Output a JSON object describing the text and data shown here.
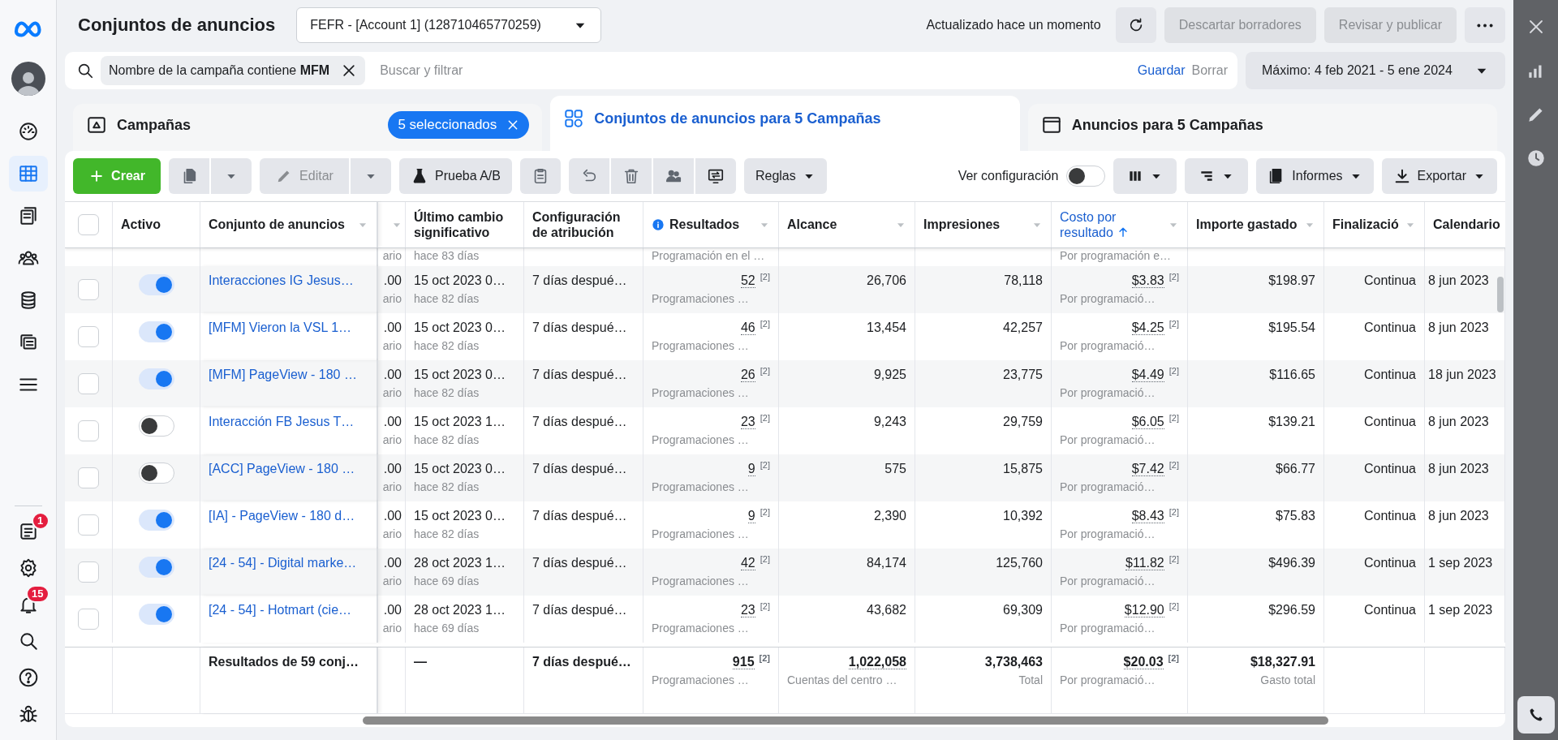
{
  "sidebar": {
    "top_items": [
      {
        "kind": "dashboard",
        "selected": false
      },
      {
        "kind": "table",
        "selected": true
      },
      {
        "kind": "pages",
        "selected": false
      },
      {
        "kind": "people",
        "selected": false
      },
      {
        "kind": "database",
        "selected": false
      },
      {
        "kind": "layers",
        "selected": false
      },
      {
        "kind": "menu",
        "selected": false
      }
    ],
    "bottom_items": [
      {
        "kind": "notes",
        "selected": false,
        "badge": "1"
      },
      {
        "kind": "settings",
        "selected": false
      },
      {
        "kind": "bell",
        "selected": false,
        "badge": "15"
      },
      {
        "kind": "search",
        "selected": false
      },
      {
        "kind": "help",
        "selected": false
      },
      {
        "kind": "bug",
        "selected": false
      }
    ]
  },
  "header": {
    "title": "Conjuntos de anuncios",
    "account": "FEFR - [Account 1] (128710465770259)",
    "status": "Actualizado hace un momento",
    "buttons": [
      {
        "label": "Descartar borradores",
        "disabled": true
      },
      {
        "label": "Revisar y publicar",
        "disabled": true
      }
    ]
  },
  "filter": {
    "chip_text": "Nombre de la campaña contiene **MFM**",
    "placeholder": "Buscar y filtrar",
    "save": "Guardar",
    "clear": "Borrar"
  },
  "date_range": "Máximo: 4 feb 2021 - 5 ene 2024",
  "tabs": [
    {
      "kind": "campaigns",
      "label": "Campañas",
      "selected": false,
      "badge": "5 seleccionados"
    },
    {
      "kind": "adsets",
      "label": "Conjuntos de anuncios para 5 Campañas",
      "selected": true
    },
    {
      "kind": "ads",
      "label": "Anuncios para 5 Campañas",
      "selected": false
    }
  ],
  "toolbar": {
    "create": "Crear",
    "edit": {
      "label": "Editar",
      "disabled": true
    },
    "ab_test": "Prueba A/B",
    "rules": "Reglas",
    "view_setup": "Ver configuración",
    "view_setup_on": false,
    "reports": "Informes",
    "export": "Exportar"
  },
  "table": {
    "select_all_checked": false,
    "columns": [
      {
        "label": "Activo",
        "sortable": false,
        "sorted": false,
        "info": false
      },
      {
        "label": "Conjunto de anuncios",
        "sortable": true,
        "sorted": false,
        "info": false
      },
      {
        "sortable": true,
        "sorted": false,
        "info": false
      },
      {
        "label": "Último cambio significativo",
        "sortable": false,
        "sorted": false,
        "info": false
      },
      {
        "label": "Configuración de atribución",
        "sortable": false,
        "sorted": false,
        "info": false
      },
      {
        "label": "Resultados",
        "sortable": true,
        "sorted": false,
        "info": true
      },
      {
        "label": "Alcance",
        "sortable": true,
        "sorted": false,
        "info": false
      },
      {
        "label": "Impresiones",
        "sortable": true,
        "sorted": false,
        "info": false
      },
      {
        "label": "Costo por resultado",
        "sortable": true,
        "sorted": true,
        "info": false
      },
      {
        "label": "Importe gastado",
        "sortable": true,
        "sorted": false,
        "info": false
      },
      {
        "label": "Finalizació",
        "sortable": true,
        "sorted": false,
        "info": false
      },
      {
        "label": "Calendario",
        "sortable": false,
        "sorted": false,
        "info": false
      }
    ],
    "partial_row": {
      "column_3_sub": "ario",
      "last_change_sub": "hace 83 días",
      "results_sub": "Programación en el …",
      "cost_sub": "Por programación e…"
    },
    "rows": [
      {
        "checked": false,
        "active": true,
        "name": "Interacciones IG Jesus…",
        "column_3": ".00",
        "column_3_sub": "ario",
        "last_change": "15 oct 2023 0…",
        "last_change_sub": "hace 82 días",
        "attribution": "7 días despué…",
        "results": "52",
        "results_note": "[2]",
        "results_sub": "Programaciones …",
        "reach": "26,706",
        "impressions": "78,118",
        "cost": "$3.83",
        "cost_note": "[2]",
        "cost_sub": "Por programació…",
        "spent": "$198.97",
        "end": "Continua",
        "schedule": "8 jun 2023"
      },
      {
        "checked": false,
        "active": true,
        "name": "[MFM] Vieron la VSL 1…",
        "column_3": ".00",
        "column_3_sub": "ario",
        "last_change": "15 oct 2023 0…",
        "last_change_sub": "hace 82 días",
        "attribution": "7 días despué…",
        "results": "46",
        "results_note": "[2]",
        "results_sub": "Programaciones …",
        "reach": "13,454",
        "impressions": "42,257",
        "cost": "$4.25",
        "cost_note": "[2]",
        "cost_sub": "Por programació…",
        "spent": "$195.54",
        "end": "Continua",
        "schedule": "8 jun 2023"
      },
      {
        "checked": false,
        "active": true,
        "name": "[MFM] PageView - 180 …",
        "column_3": ".00",
        "column_3_sub": "ario",
        "last_change": "15 oct 2023 0…",
        "last_change_sub": "hace 82 días",
        "attribution": "7 días despué…",
        "results": "26",
        "results_note": "[2]",
        "results_sub": "Programaciones …",
        "reach": "9,925",
        "impressions": "23,775",
        "cost": "$4.49",
        "cost_note": "[2]",
        "cost_sub": "Por programació…",
        "spent": "$116.65",
        "end": "Continua",
        "schedule": "18 jun 2023"
      },
      {
        "checked": false,
        "active": false,
        "name": "Interacción FB Jesus T…",
        "column_3": ".00",
        "column_3_sub": "ario",
        "last_change": "15 oct 2023 1…",
        "last_change_sub": "hace 82 días",
        "attribution": "7 días despué…",
        "results": "23",
        "results_note": "[2]",
        "results_sub": "Programaciones …",
        "reach": "9,243",
        "impressions": "29,759",
        "cost": "$6.05",
        "cost_note": "[2]",
        "cost_sub": "Por programació…",
        "spent": "$139.21",
        "end": "Continua",
        "schedule": "8 jun 2023"
      },
      {
        "checked": false,
        "active": false,
        "name": "[ACC] PageView - 180 …",
        "column_3": ".00",
        "column_3_sub": "ario",
        "last_change": "15 oct 2023 0…",
        "last_change_sub": "hace 82 días",
        "attribution": "7 días despué…",
        "results": "9",
        "results_note": "[2]",
        "results_sub": "Programaciones …",
        "reach": "575",
        "impressions": "15,875",
        "cost": "$7.42",
        "cost_note": "[2]",
        "cost_sub": "Por programació…",
        "spent": "$66.77",
        "end": "Continua",
        "schedule": "8 jun 2023"
      },
      {
        "checked": false,
        "active": true,
        "name": "[IA] - PageView - 180 d…",
        "column_3": ".00",
        "column_3_sub": "ario",
        "last_change": "15 oct 2023 0…",
        "last_change_sub": "hace 82 días",
        "attribution": "7 días despué…",
        "results": "9",
        "results_note": "[2]",
        "results_sub": "Programaciones …",
        "reach": "2,390",
        "impressions": "10,392",
        "cost": "$8.43",
        "cost_note": "[2]",
        "cost_sub": "Por programació…",
        "spent": "$75.83",
        "end": "Continua",
        "schedule": "8 jun 2023"
      },
      {
        "checked": false,
        "active": true,
        "name": "[24 - 54] - Digital marke…",
        "column_3": ".00",
        "column_3_sub": "ario",
        "last_change": "28 oct 2023 1…",
        "last_change_sub": "hace 69 días",
        "attribution": "7 días despué…",
        "results": "42",
        "results_note": "[2]",
        "results_sub": "Programaciones …",
        "reach": "84,174",
        "impressions": "125,760",
        "cost": "$11.82",
        "cost_note": "[2]",
        "cost_sub": "Por programació…",
        "spent": "$496.39",
        "end": "Continua",
        "schedule": "1 sep 2023"
      },
      {
        "checked": false,
        "active": true,
        "name": "[24 - 54] - Hotmart (cie…",
        "column_3": ".00",
        "column_3_sub": "ario",
        "last_change": "28 oct 2023 1…",
        "last_change_sub": "hace 69 días",
        "attribution": "7 días despué…",
        "results": "23",
        "results_note": "[2]",
        "results_sub": "Programaciones …",
        "reach": "43,682",
        "impressions": "69,309",
        "cost": "$12.90",
        "cost_note": "[2]",
        "cost_sub": "Por programació…",
        "spent": "$296.59",
        "end": "Continua",
        "schedule": "1 sep 2023"
      }
    ],
    "footer": {
      "label": "Resultados de 59 conj…",
      "last_change": "—",
      "attribution": "7 días despué…",
      "results": "915",
      "results_note": "[2]",
      "results_sub": "Programaciones …",
      "reach": "1,022,058",
      "reach_sub": "Cuentas del centro …",
      "impressions": "3,738,463",
      "impressions_sub": "Total",
      "cost": "$20.03",
      "cost_note": "[2]",
      "cost_sub": "Por programació…",
      "spent": "$18,327.91",
      "spent_sub": "Gasto total"
    }
  }
}
